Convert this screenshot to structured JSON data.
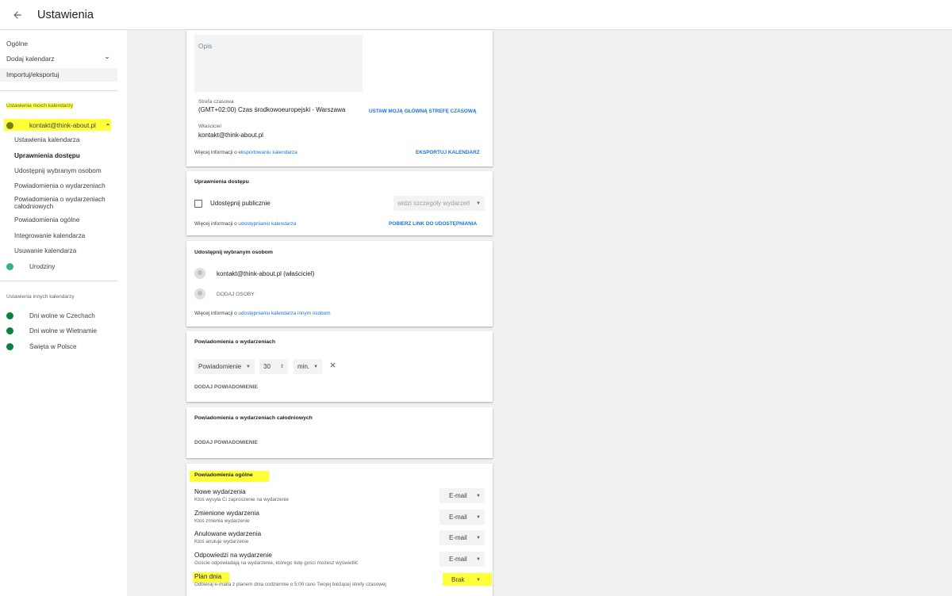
{
  "header": {
    "title": "Ustawienia",
    "back_icon": "arrow-left-icon"
  },
  "sidebar": {
    "general": "Ogólne",
    "add_calendar": "Dodaj kalendarz",
    "import_export": "Importuj/eksportuj",
    "my_calendars_heading": "Ustawienia moich kalendarzy",
    "my_calendars": [
      {
        "name": "kontakt@think-about.pl",
        "color": "#7a7a21"
      }
    ],
    "sub_items": [
      "Ustawienia kalendarza",
      "Uprawnienia dostępu",
      "Udostępnij wybranym osobom",
      "Powiadomienia o wydarzeniach",
      "Powiadomienia o wydarzeniach całodniowych",
      "Powiadomienia ogólne",
      "Integrowanie kalendarza",
      "Usuwanie kalendarza"
    ],
    "birthdays": {
      "name": "Urodziny",
      "color": "#33b679"
    },
    "other_calendars_heading": "Ustawienia innych kalendarzy",
    "other_calendars": [
      {
        "name": "Dni wolne w Czechach",
        "color": "#0b8043"
      },
      {
        "name": "Dni wolne w Wietnamie",
        "color": "#0b8043"
      },
      {
        "name": "Święta w Polsce",
        "color": "#0b8043"
      }
    ]
  },
  "calendar_settings": {
    "description_placeholder": "Opis",
    "timezone_label": "Strefa czasowa",
    "timezone_value": "(GMT+02:00) Czas środkowoeuropejski - Warszawa",
    "set_timezone_action": "USTAW MOJĄ GŁÓWNĄ STREFĘ CZASOWĄ",
    "owner_label": "Właściciel",
    "owner_value": "kontakt@think-about.pl",
    "info_prefix": "Więcej informacji o",
    "info_link": "eksportowaniu kalendarza",
    "export_action": "EKSPORTUJ KALENDARZ"
  },
  "access": {
    "title": "Uprawnienia dostępu",
    "public_label": "Udostępnij publicznie",
    "visibility_select": "widzi szczegóły wydarzeń",
    "info_prefix": "Więcej informacji o",
    "info_link": "udostępnianiu kalendarza",
    "get_link_action": "POBIERZ LINK DO UDOSTĘPNIANIA"
  },
  "share": {
    "title": "Udostępnij wybranym osobom",
    "person": "kontakt@think-about.pl (właściciel)",
    "add_people": "DODAJ OSOBY",
    "info_prefix": "Więcej informacji o",
    "info_link": "udostępnianiu kalendarza innym osobom"
  },
  "event_notifications": {
    "title": "Powiadomienia o wydarzeniach",
    "type": "Powiadomienie",
    "value": "30",
    "unit": "min.",
    "add": "DODAJ POWIADOMIENIE"
  },
  "allday_notifications": {
    "title": "Powiadomienia o wydarzeniach całodniowych",
    "add": "DODAJ POWIADOMIENIE"
  },
  "general_notifications": {
    "title": "Powiadomienia ogólne",
    "rows": [
      {
        "name": "Nowe wydarzenia",
        "desc": "Ktoś wysyła Ci zaproszenie na wydarzenie",
        "value": "E-mail"
      },
      {
        "name": "Zmienione wydarzenia",
        "desc": "Ktoś zmienia wydarzenie",
        "value": "E-mail"
      },
      {
        "name": "Anulowane wydarzenia",
        "desc": "Ktoś anuluje wydarzenie",
        "value": "E-mail"
      },
      {
        "name": "Odpowiedzi na wydarzenie",
        "desc": "Goście odpowiadają na wydarzenie, którego listę gości możesz wyświetlić",
        "value": "E-mail"
      },
      {
        "name": "Plan dnia",
        "desc": "Odbieraj e-maila z planem dnia codziennie o 5:00 rano Twojej bieżącej strefy czasowej",
        "value": "Brak"
      }
    ]
  },
  "colors": {
    "highlight": "#ffff3a",
    "link": "#1a73e8"
  }
}
